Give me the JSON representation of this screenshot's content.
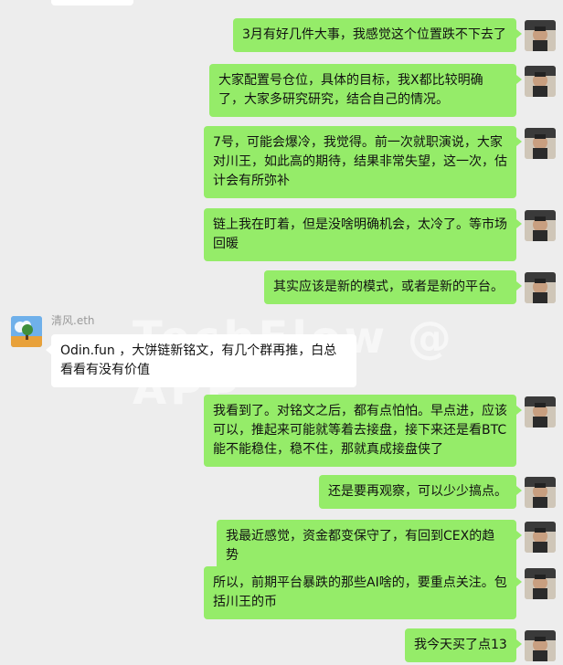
{
  "watermark": "TechFlow @ APP",
  "other_sender": "清风.eth",
  "messages": [
    {
      "text": "3月有好几件大事，我感觉这个位置跌不下去了"
    },
    {
      "text": "大家配置号仓位，具体的目标，我X都比较明确了，大家多研究研究，结合自己的情况。"
    },
    {
      "text": "7号，可能会爆冷，我觉得。前一次就职演说，大家对川王，如此高的期待，结果非常失望，这一次，估计会有所弥补"
    },
    {
      "text": "链上我在盯着，但是没啥明确机会，太冷了。等市场回暖"
    },
    {
      "text": "其实应该是新的模式，或者是新的平台。"
    },
    {
      "text": "Odin.fun ，大饼链新铭文，有几个群再推，白总看看有没有价值"
    },
    {
      "text": "我看到了。对铭文之后，都有点怕怕。早点进，应该可以，推起来可能就等着去接盘，接下来还是看BTC能不能稳住，稳不住，那就真成接盘侠了"
    },
    {
      "text": "还是要再观察，可以少少搞点。"
    },
    {
      "text": "我最近感觉，资金都变保守了，有回到CEX的趋势"
    },
    {
      "text": "所以，前期平台暴跌的那些AI啥的，要重点关注。包括川王的币"
    },
    {
      "text": "我今天买了点13"
    }
  ],
  "colors": {
    "background": "#ededed",
    "self_bubble": "#95ec69",
    "other_bubble": "#ffffff"
  }
}
